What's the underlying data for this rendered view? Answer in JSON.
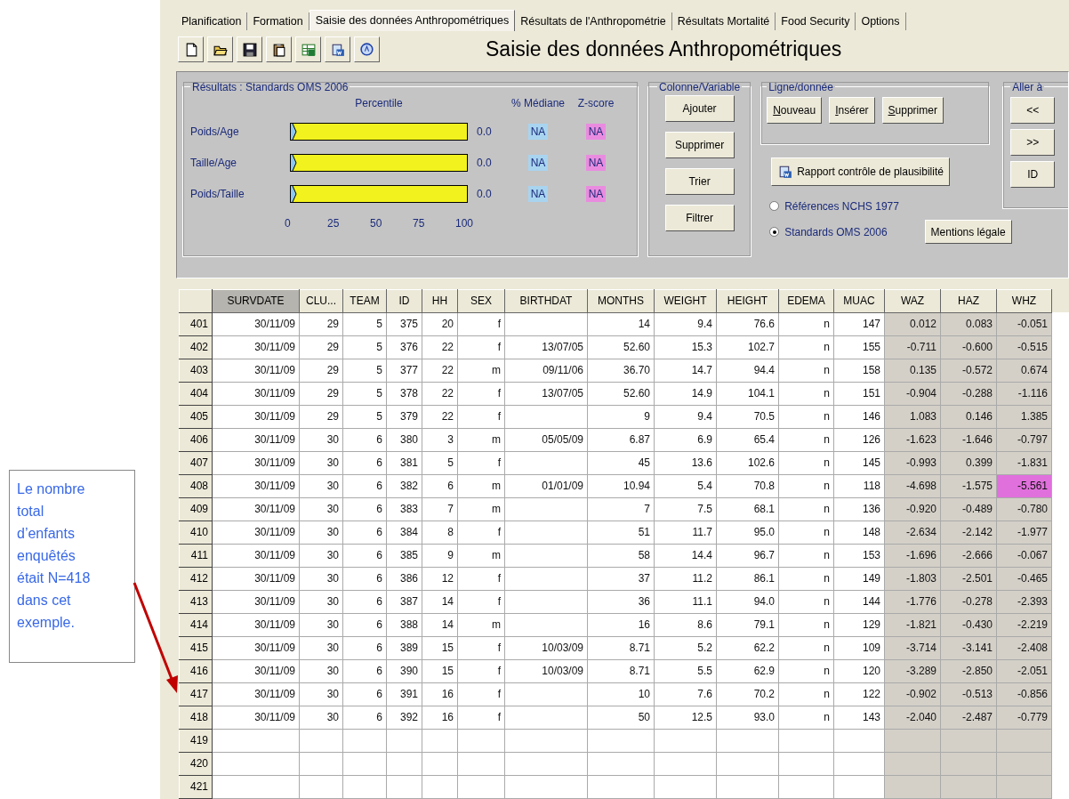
{
  "callout": {
    "text": "Le nombre total d’enfants enquêtés était N=418 dans cet exemple."
  },
  "tabs": [
    {
      "label": "Planification",
      "selected": false
    },
    {
      "label": "Formation",
      "selected": false
    },
    {
      "label": "Saisie des données Anthropométriques",
      "selected": true
    },
    {
      "label": "Résultats de l'Anthropométrie",
      "selected": false
    },
    {
      "label": "Résultats Mortalité",
      "selected": false
    },
    {
      "label": "Food Security",
      "selected": false
    },
    {
      "label": "Options",
      "selected": false
    }
  ],
  "toolbar": {
    "title": "Saisie des données Anthropométriques"
  },
  "results": {
    "title": "Résultats : Standards OMS 2006",
    "percentile_label": "Percentile",
    "median_label": "% Médiane",
    "zscore_label": "Z-score",
    "rows": [
      {
        "label": "Poids/Age",
        "level": 0,
        "percentile": "0.0",
        "median": "NA",
        "zscore": "NA"
      },
      {
        "label": "Taille/Age",
        "level": 0,
        "percentile": "0.0",
        "median": "NA",
        "zscore": "NA"
      },
      {
        "label": "Poids/Taille",
        "level": 0,
        "percentile": "0.0",
        "median": "NA",
        "zscore": "NA"
      }
    ],
    "scale": [
      "0",
      "25",
      "50",
      "75",
      "100"
    ]
  },
  "column_group": {
    "title": "Colonne/Variable",
    "buttons": [
      "Ajouter",
      "Supprimer",
      "Trier",
      "Filtrer"
    ]
  },
  "row_group": {
    "title": "Ligne/donnée",
    "buttons": [
      "Nouveau",
      "Insérer",
      "Supprimer"
    ]
  },
  "report_button": "Rapport contrôle de plausibilité",
  "references": [
    {
      "label": "Références NCHS 1977",
      "selected": false
    },
    {
      "label": "Standards OMS 2006",
      "selected": true
    }
  ],
  "goto_group": {
    "title": "Aller à",
    "buttons": [
      "<<",
      ">>",
      "ID"
    ]
  },
  "legal_button": "Mentions légale",
  "table": {
    "columns": [
      {
        "label": "SURVDATE",
        "selected": true,
        "kind": "input"
      },
      {
        "label": "CLU...",
        "selected": false,
        "kind": "input"
      },
      {
        "label": "TEAM",
        "selected": false,
        "kind": "input"
      },
      {
        "label": "ID",
        "selected": false,
        "kind": "input"
      },
      {
        "label": "HH",
        "selected": false,
        "kind": "input"
      },
      {
        "label": "SEX",
        "selected": false,
        "kind": "input"
      },
      {
        "label": "BIRTHDAT",
        "selected": false,
        "kind": "input"
      },
      {
        "label": "MONTHS",
        "selected": false,
        "kind": "input"
      },
      {
        "label": "WEIGHT",
        "selected": false,
        "kind": "input"
      },
      {
        "label": "HEIGHT",
        "selected": false,
        "kind": "input"
      },
      {
        "label": "EDEMA",
        "selected": false,
        "kind": "input"
      },
      {
        "label": "MUAC",
        "selected": false,
        "kind": "input"
      },
      {
        "label": "WAZ",
        "selected": false,
        "kind": "computed"
      },
      {
        "label": "HAZ",
        "selected": false,
        "kind": "computed"
      },
      {
        "label": "WHZ",
        "selected": false,
        "kind": "computed"
      }
    ],
    "rows": [
      {
        "num": "401",
        "alert": false,
        "cells": [
          "30/11/09",
          "29",
          "5",
          "375",
          "20",
          "f",
          null,
          "14",
          "9.4",
          "76.6",
          "n",
          "147",
          "0.012",
          "0.083",
          "-0.051"
        ]
      },
      {
        "num": "402",
        "alert": false,
        "cells": [
          "30/11/09",
          "29",
          "5",
          "376",
          "22",
          "f",
          "13/07/05",
          "52.60",
          "15.3",
          "102.7",
          "n",
          "155",
          "-0.711",
          "-0.600",
          "-0.515"
        ]
      },
      {
        "num": "403",
        "alert": false,
        "cells": [
          "30/11/09",
          "29",
          "5",
          "377",
          "22",
          "m",
          "09/11/06",
          "36.70",
          "14.7",
          "94.4",
          "n",
          "158",
          "0.135",
          "-0.572",
          "0.674"
        ]
      },
      {
        "num": "404",
        "alert": false,
        "cells": [
          "30/11/09",
          "29",
          "5",
          "378",
          "22",
          "f",
          "13/07/05",
          "52.60",
          "14.9",
          "104.1",
          "n",
          "151",
          "-0.904",
          "-0.288",
          "-1.116"
        ]
      },
      {
        "num": "405",
        "alert": false,
        "cells": [
          "30/11/09",
          "29",
          "5",
          "379",
          "22",
          "f",
          null,
          "9",
          "9.4",
          "70.5",
          "n",
          "146",
          "1.083",
          "0.146",
          "1.385"
        ]
      },
      {
        "num": "406",
        "alert": false,
        "cells": [
          "30/11/09",
          "30",
          "6",
          "380",
          "3",
          "m",
          "05/05/09",
          "6.87",
          "6.9",
          "65.4",
          "n",
          "126",
          "-1.623",
          "-1.646",
          "-0.797"
        ]
      },
      {
        "num": "407",
        "alert": false,
        "cells": [
          "30/11/09",
          "30",
          "6",
          "381",
          "5",
          "f",
          null,
          "45",
          "13.6",
          "102.6",
          "n",
          "145",
          "-0.993",
          "0.399",
          "-1.831"
        ]
      },
      {
        "num": "408",
        "alert": true,
        "cells": [
          "30/11/09",
          "30",
          "6",
          "382",
          "6",
          "m",
          "01/01/09",
          "10.94",
          "5.4",
          "70.8",
          "n",
          "118",
          "-4.698",
          "-1.575",
          "-5.561"
        ]
      },
      {
        "num": "409",
        "alert": false,
        "cells": [
          "30/11/09",
          "30",
          "6",
          "383",
          "7",
          "m",
          null,
          "7",
          "7.5",
          "68.1",
          "n",
          "136",
          "-0.920",
          "-0.489",
          "-0.780"
        ]
      },
      {
        "num": "410",
        "alert": false,
        "cells": [
          "30/11/09",
          "30",
          "6",
          "384",
          "8",
          "f",
          null,
          "51",
          "11.7",
          "95.0",
          "n",
          "148",
          "-2.634",
          "-2.142",
          "-1.977"
        ]
      },
      {
        "num": "411",
        "alert": false,
        "cells": [
          "30/11/09",
          "30",
          "6",
          "385",
          "9",
          "m",
          null,
          "58",
          "14.4",
          "96.7",
          "n",
          "153",
          "-1.696",
          "-2.666",
          "-0.067"
        ]
      },
      {
        "num": "412",
        "alert": false,
        "cells": [
          "30/11/09",
          "30",
          "6",
          "386",
          "12",
          "f",
          null,
          "37",
          "11.2",
          "86.1",
          "n",
          "149",
          "-1.803",
          "-2.501",
          "-0.465"
        ]
      },
      {
        "num": "413",
        "alert": false,
        "cells": [
          "30/11/09",
          "30",
          "6",
          "387",
          "14",
          "f",
          null,
          "36",
          "11.1",
          "94.0",
          "n",
          "144",
          "-1.776",
          "-0.278",
          "-2.393"
        ]
      },
      {
        "num": "414",
        "alert": false,
        "cells": [
          "30/11/09",
          "30",
          "6",
          "388",
          "14",
          "m",
          null,
          "16",
          "8.6",
          "79.1",
          "n",
          "129",
          "-1.821",
          "-0.430",
          "-2.219"
        ]
      },
      {
        "num": "415",
        "alert": false,
        "cells": [
          "30/11/09",
          "30",
          "6",
          "389",
          "15",
          "f",
          "10/03/09",
          "8.71",
          "5.2",
          "62.2",
          "n",
          "109",
          "-3.714",
          "-3.141",
          "-2.408"
        ]
      },
      {
        "num": "416",
        "alert": false,
        "cells": [
          "30/11/09",
          "30",
          "6",
          "390",
          "15",
          "f",
          "10/03/09",
          "8.71",
          "5.5",
          "62.9",
          "n",
          "120",
          "-3.289",
          "-2.850",
          "-2.051"
        ]
      },
      {
        "num": "417",
        "alert": false,
        "cells": [
          "30/11/09",
          "30",
          "6",
          "391",
          "16",
          "f",
          null,
          "10",
          "7.6",
          "70.2",
          "n",
          "122",
          "-0.902",
          "-0.513",
          "-0.856"
        ]
      },
      {
        "num": "418",
        "alert": false,
        "cells": [
          "30/11/09",
          "30",
          "6",
          "392",
          "16",
          "f",
          null,
          "50",
          "12.5",
          "93.0",
          "n",
          "143",
          "-2.040",
          "-2.487",
          "-0.779"
        ]
      },
      {
        "num": "419"
      },
      {
        "num": "420"
      },
      {
        "num": "421"
      }
    ]
  }
}
